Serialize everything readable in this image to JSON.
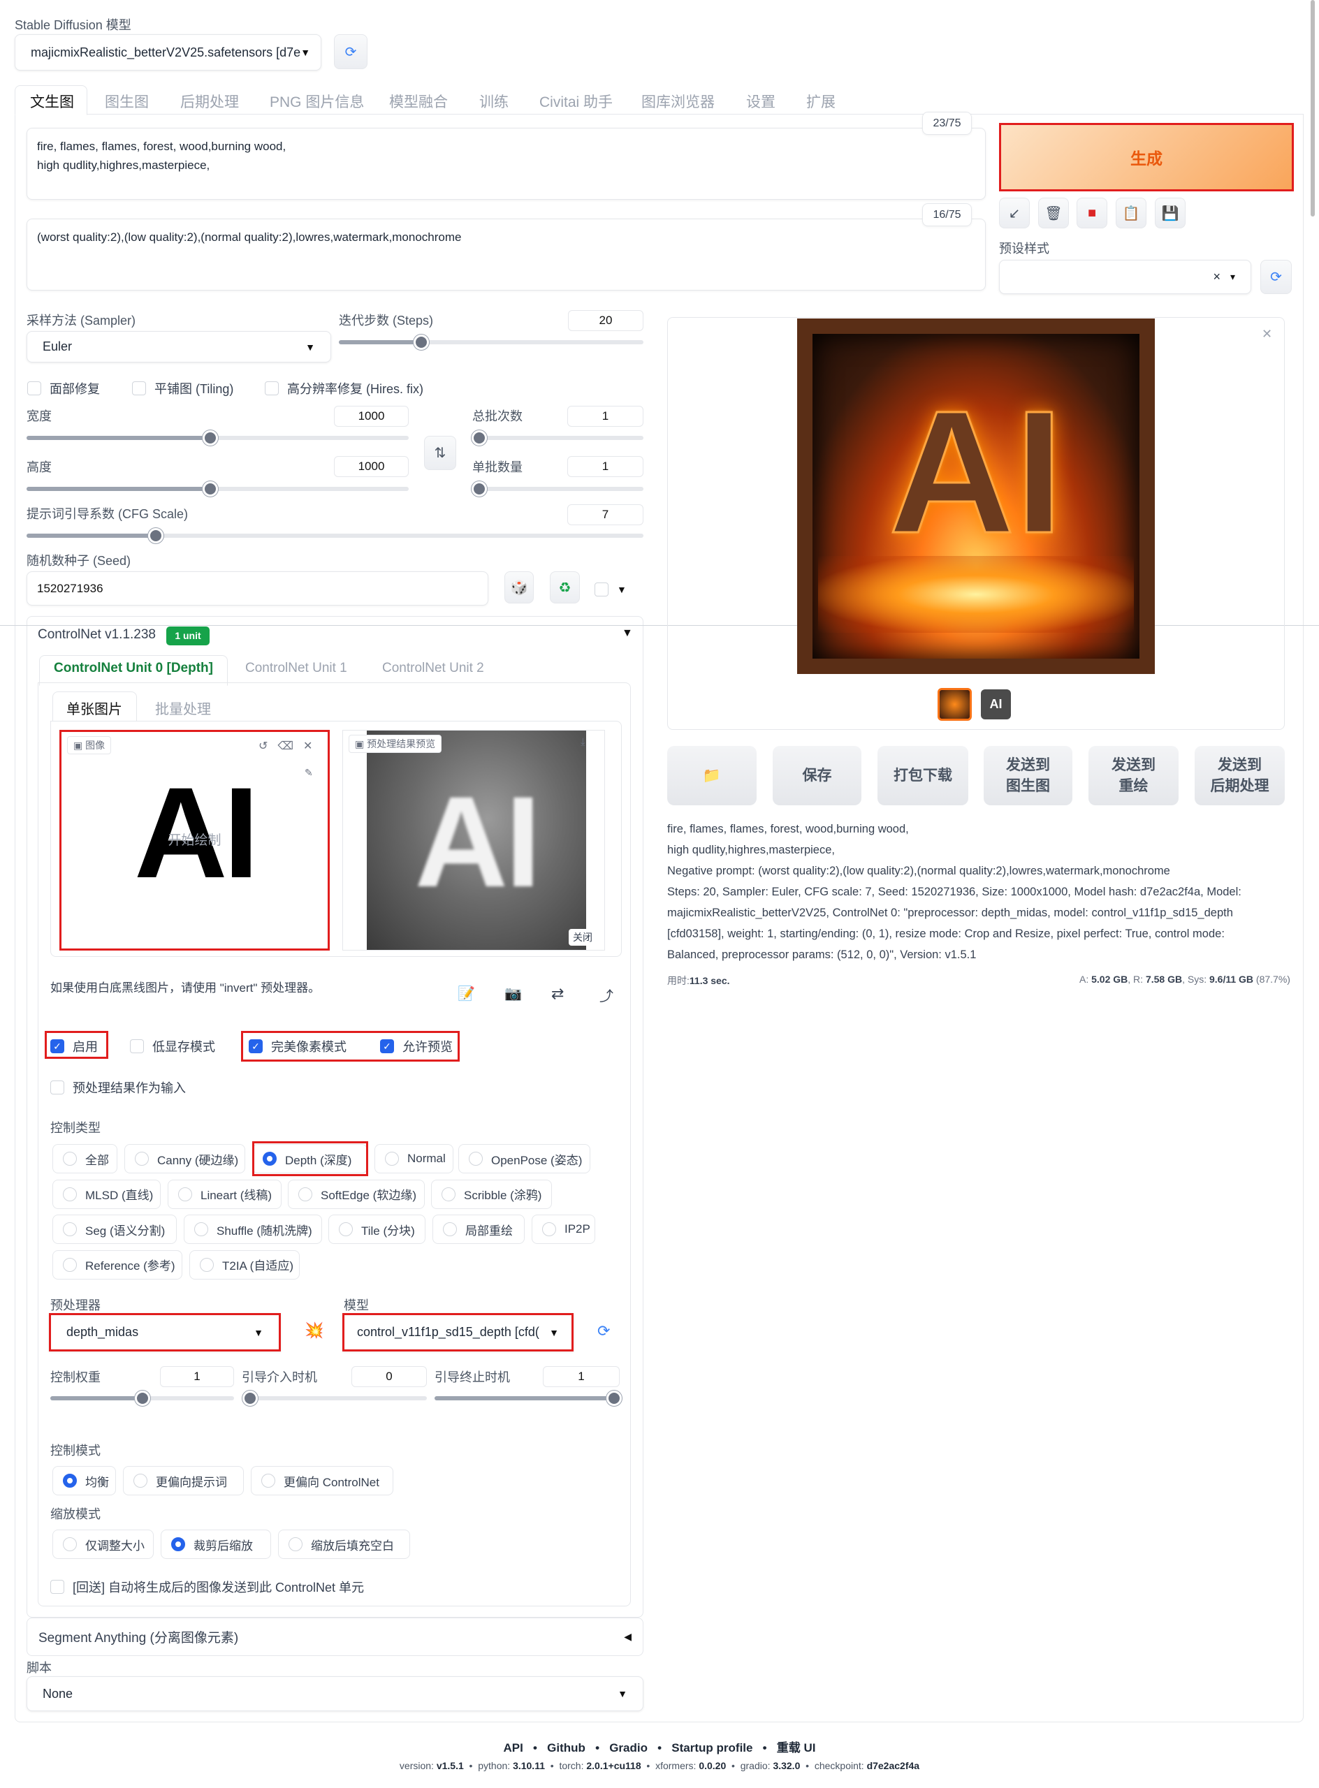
{
  "model": {
    "label": "Stable Diffusion 模型",
    "value": "majicmixRealistic_betterV2V25.safetensors [d7e"
  },
  "tabs": [
    "文生图",
    "图生图",
    "后期处理",
    "PNG 图片信息",
    "模型融合",
    "训练",
    "Civitai 助手",
    "图库浏览器",
    "设置",
    "扩展"
  ],
  "prompt": {
    "text1": "fire, flames, flames, forest, wood,burning wood,",
    "text2": "high qudlity,highres,masterpiece,",
    "counter": "23/75"
  },
  "negative": {
    "text": "(worst quality:2),(low quality:2),(normal quality:2),lowres,watermark,monochrome",
    "counter": "16/75"
  },
  "generate_label": "生成",
  "styles_label": "预设样式",
  "sampler": {
    "label": "采样方法 (Sampler)",
    "value": "Euler"
  },
  "steps": {
    "label": "迭代步数 (Steps)",
    "value": "20",
    "fraction": 0.27
  },
  "checks": {
    "face": "面部修复",
    "tiling": "平铺图 (Tiling)",
    "hires": "高分辨率修复 (Hires. fix)"
  },
  "width": {
    "label": "宽度",
    "value": "1000",
    "fraction": 0.48
  },
  "height": {
    "label": "高度",
    "value": "1000",
    "fraction": 0.48
  },
  "batch_count": {
    "label": "总批次数",
    "value": "1",
    "fraction": 0.0
  },
  "batch_size": {
    "label": "单批数量",
    "value": "1",
    "fraction": 0.0
  },
  "cfg": {
    "label": "提示词引导系数 (CFG Scale)",
    "value": "7",
    "fraction": 0.21
  },
  "seed": {
    "label": "随机数种子 (Seed)",
    "value": "1520271936"
  },
  "controlnet": {
    "title": "ControlNet v1.1.238",
    "badge": "1 unit",
    "units": [
      "ControlNet Unit 0 [Depth]",
      "ControlNet Unit 1",
      "ControlNet Unit 2"
    ],
    "subtabs": [
      "单张图片",
      "批量处理"
    ],
    "image_label": "图像",
    "image_text": "AI",
    "draw_hint": "开始绘制",
    "preview_label": "预处理结果预览",
    "close_label": "关闭",
    "hint": "如果使用白底黑线图片，请使用 \"invert\" 预处理器。",
    "enable": "启用",
    "lowvram": "低显存模式",
    "pixel_perfect": "完美像素模式",
    "allow_preview": "允许预览",
    "preview_as_input": "预处理结果作为输入",
    "control_type_label": "控制类型",
    "types": [
      "全部",
      "Canny (硬边缘)",
      "Depth (深度)",
      "Normal",
      "OpenPose (姿态)",
      "MLSD (直线)",
      "Lineart (线稿)",
      "SoftEdge (软边缘)",
      "Scribble (涂鸦)",
      "Seg (语义分割)",
      "Shuffle (随机洗牌)",
      "Tile (分块)",
      "局部重绘",
      "IP2P",
      "Reference (参考)",
      "T2IA (自适应)"
    ],
    "selected_type": "Depth (深度)",
    "preprocessor": {
      "label": "预处理器",
      "value": "depth_midas"
    },
    "cn_model": {
      "label": "模型",
      "value": "control_v11f1p_sd15_depth [cfd("
    },
    "weight": {
      "label": "控制权重",
      "value": "1",
      "fraction": 0.5
    },
    "start": {
      "label": "引导介入时机",
      "value": "0",
      "fraction": 0.0
    },
    "end": {
      "label": "引导终止时机",
      "value": "1",
      "fraction": 1.0
    },
    "mode_label": "控制模式",
    "modes": [
      "均衡",
      "更偏向提示词",
      "更偏向 ControlNet"
    ],
    "selected_mode": "均衡",
    "resize_label": "缩放模式",
    "resizes": [
      "仅调整大小",
      "裁剪后缩放",
      "缩放后填充空白"
    ],
    "selected_resize": "裁剪后缩放",
    "loopback": "[回送] 自动将生成后的图像发送到此 ControlNet 单元"
  },
  "segment_anything": "Segment Anything (分离图像元素)",
  "script": {
    "label": "脚本",
    "value": "None"
  },
  "output_buttons": [
    "保存",
    "打包下载",
    "发送到\n图生图",
    "发送到\n重绘",
    "发送到\n后期处理"
  ],
  "output_info": [
    "fire, flames, flames, forest, wood,burning wood,",
    "high qudlity,highres,masterpiece,",
    "Negative prompt: (worst quality:2),(low quality:2),(normal quality:2),lowres,watermark,monochrome",
    "Steps: 20, Sampler: Euler, CFG scale: 7, Seed: 1520271936, Size: 1000x1000, Model hash: d7e2ac2f4a, Model:",
    "majicmixRealistic_betterV2V25, ControlNet 0: \"preprocessor: depth_midas, model: control_v11f1p_sd15_depth",
    "[cfd03158], weight: 1, starting/ending: (0, 1), resize mode: Crop and Resize, pixel perfect: True, control mode:",
    "Balanced, preprocessor params: (512, 0, 0)\", Version: v1.5.1"
  ],
  "timing": {
    "label": "用时:",
    "value": "11.3 sec."
  },
  "memory": {
    "a_label": "A:",
    "a": "5.02 GB",
    "r_label": "R:",
    "r": "7.58 GB",
    "sys_label": "Sys:",
    "sys": "9.6/11 GB",
    "pct": "(87.7%)"
  },
  "output_image_text": "AI",
  "footer": {
    "links": [
      "API",
      "Github",
      "Gradio",
      "Startup profile",
      "重载 UI"
    ],
    "version": [
      [
        "version: ",
        "v1.5.1"
      ],
      [
        "python: ",
        "3.10.11"
      ],
      [
        "torch: ",
        "2.0.1+cu118"
      ],
      [
        "xformers: ",
        "0.0.20"
      ],
      [
        "gradio: ",
        "3.32.0"
      ],
      [
        "checkpoint: ",
        "d7e2ac2f4a"
      ]
    ]
  },
  "colors": {
    "accent": "#2563eb",
    "generate": "#f59e4b",
    "highlight": "#e11d1d",
    "badge": "#16a34a"
  }
}
